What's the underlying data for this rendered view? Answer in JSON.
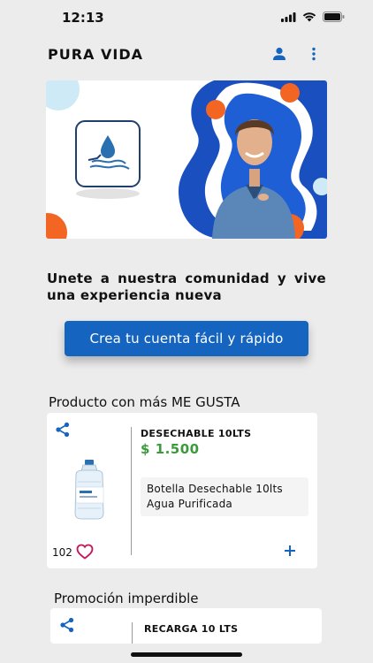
{
  "status_bar": {
    "time": "12:13"
  },
  "header": {
    "title": "PURA VIDA",
    "profile_icon": "user-icon",
    "menu_icon": "more-vertical-icon"
  },
  "banner": {
    "logo_icon": "water-drop-hand-icon"
  },
  "promo": {
    "text": "Unete a nuestra comunidad y vive una experiencia nueva"
  },
  "cta": {
    "label": "Crea tu cuenta fácil y rápido"
  },
  "sections": [
    {
      "title": "Producto con más ME GUSTA",
      "product": {
        "name": "DESECHABLE 10LTS",
        "price": "$ 1.500",
        "description": "Botella Desechable 10lts Agua Purificada",
        "likes": "102"
      }
    },
    {
      "title": "Promoción imperdible",
      "product": {
        "name": "RECARGA 10 LTS"
      }
    }
  ],
  "colors": {
    "primary": "#1565c0",
    "price_green": "#3b9a3b",
    "accent_orange": "#f26522",
    "heart": "#c2185b"
  }
}
